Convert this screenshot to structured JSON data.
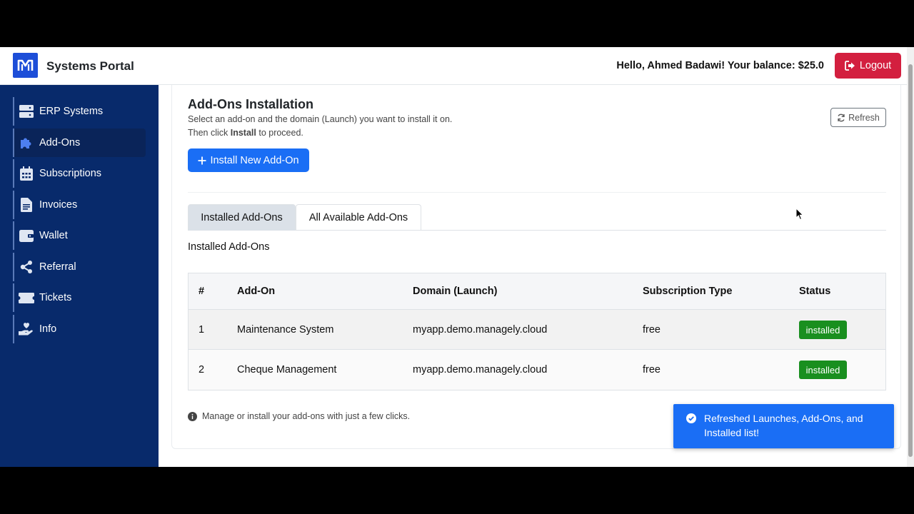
{
  "header": {
    "app_title": "Systems Portal",
    "greeting": "Hello, Ahmed Badawi! Your balance: $25.0",
    "logout_label": "Logout"
  },
  "sidebar": {
    "items": [
      {
        "label": "ERP Systems",
        "icon": "server-icon",
        "active": false
      },
      {
        "label": "Add-Ons",
        "icon": "puzzle-icon",
        "active": true
      },
      {
        "label": "Subscriptions",
        "icon": "calendar-icon",
        "active": false
      },
      {
        "label": "Invoices",
        "icon": "file-invoice-icon",
        "active": false
      },
      {
        "label": "Wallet",
        "icon": "wallet-icon",
        "active": false
      },
      {
        "label": "Referral",
        "icon": "share-icon",
        "active": false
      },
      {
        "label": "Tickets",
        "icon": "ticket-icon",
        "active": false
      },
      {
        "label": "Info",
        "icon": "hand-holding-heart-icon",
        "active": false
      }
    ]
  },
  "main": {
    "title": "Add-Ons Installation",
    "subtitle_line1": "Select an add-on and the domain (Launch) you want to install it on.",
    "subtitle_line2_prefix": "Then click ",
    "subtitle_line2_bold": "Install",
    "subtitle_line2_suffix": " to proceed.",
    "refresh_label": "Refresh",
    "install_button_label": "Install New Add-On",
    "tabs": [
      {
        "label": "Installed Add-Ons",
        "active": true
      },
      {
        "label": "All Available Add-Ons",
        "active": false
      }
    ],
    "section_label": "Installed Add-Ons",
    "table": {
      "headers": [
        "#",
        "Add-On",
        "Domain (Launch)",
        "Subscription Type",
        "Status"
      ],
      "rows": [
        {
          "num": "1",
          "addon": "Maintenance System",
          "domain": "myapp.demo.managely.cloud",
          "subscription": "free",
          "status": "installed"
        },
        {
          "num": "2",
          "addon": "Cheque Management",
          "domain": "myapp.demo.managely.cloud",
          "subscription": "free",
          "status": "installed"
        }
      ]
    },
    "footer_note": "Manage or install your add-ons with just a few clicks."
  },
  "toast": {
    "message": "Refreshed Launches, Add-Ons, and Installed list!"
  },
  "colors": {
    "sidebar_bg": "#082a6b",
    "primary": "#1a6ef5",
    "danger": "#d31f3f",
    "success": "#198f1f"
  }
}
